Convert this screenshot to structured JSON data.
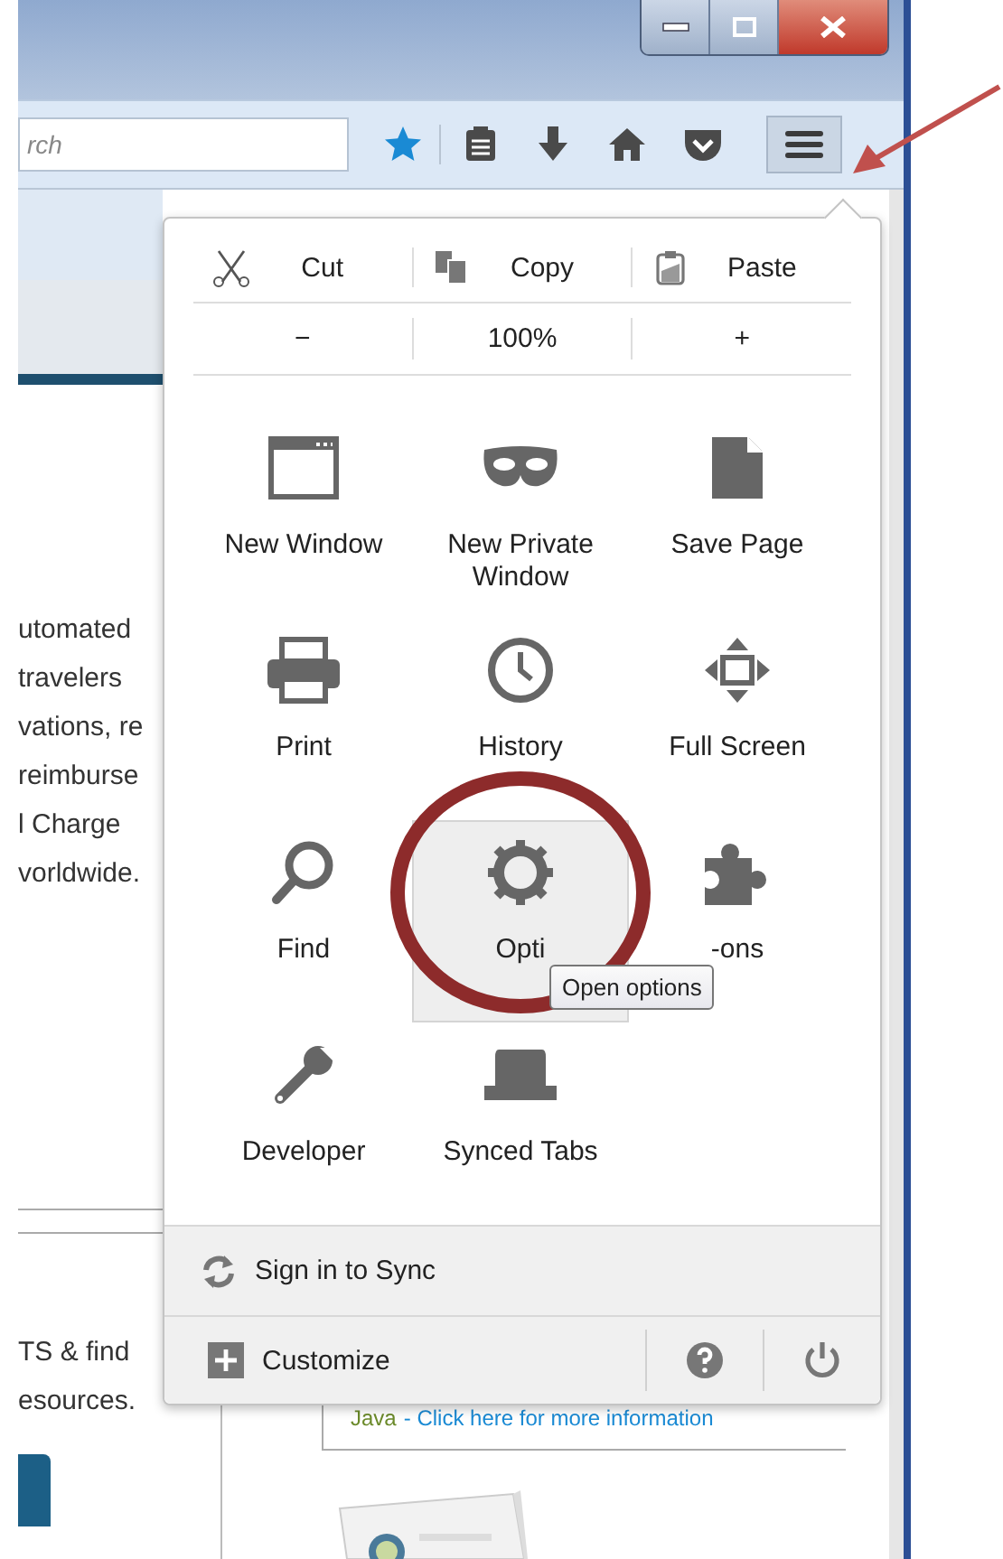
{
  "toolbar": {
    "search": {
      "placeholder": "rch"
    }
  },
  "page": {
    "lines": [
      "utomated",
      "travelers",
      "vations, re",
      "reimburse",
      "l Charge",
      "vorldwide."
    ],
    "lower_lines": [
      "TS & find",
      "esources."
    ],
    "java_note": {
      "label": "Java",
      "link": "- Click here for more information"
    }
  },
  "menu": {
    "edit_row": [
      {
        "kind": "cut",
        "label": "Cut"
      },
      {
        "kind": "copy",
        "label": "Copy"
      },
      {
        "kind": "paste",
        "label": "Paste"
      }
    ],
    "zoom": {
      "out": "−",
      "level": "100%",
      "in": "+"
    },
    "items": [
      {
        "kind": "window",
        "label": "New Window",
        "hovered": false
      },
      {
        "kind": "mask",
        "label": "New Private Window",
        "hovered": false
      },
      {
        "kind": "page",
        "label": "Save Page",
        "hovered": false
      },
      {
        "kind": "printer",
        "label": "Print",
        "hovered": false
      },
      {
        "kind": "clock",
        "label": "History",
        "hovered": false
      },
      {
        "kind": "fullscreen",
        "label": "Full Screen",
        "hovered": false
      },
      {
        "kind": "search",
        "label": "Find",
        "hovered": false
      },
      {
        "kind": "gear",
        "label": "Opti",
        "hovered": true
      },
      {
        "kind": "puzzle",
        "label": "-ons",
        "hovered": false
      },
      {
        "kind": "wrench",
        "label": "Developer",
        "hovered": false
      },
      {
        "kind": "tabs",
        "label": "Synced Tabs",
        "hovered": false
      }
    ],
    "sign_in": "Sign in to Sync",
    "customize": "Customize"
  },
  "tooltip": "Open options"
}
